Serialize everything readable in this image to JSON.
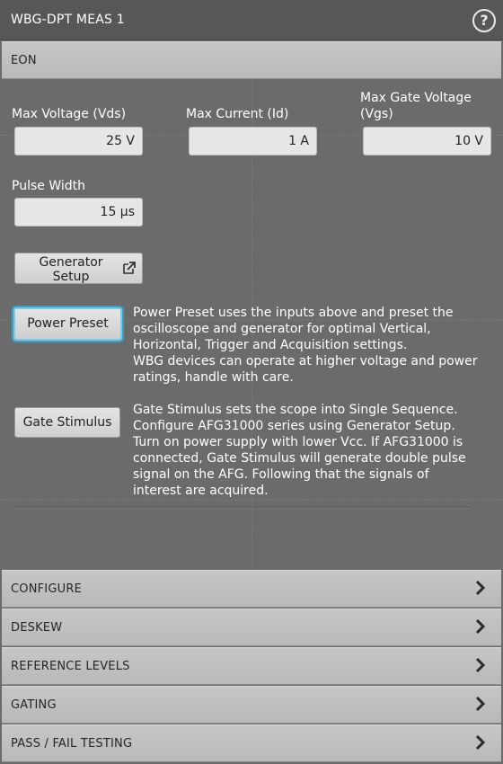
{
  "title": "WBG-DPT MEAS 1",
  "help_icon": "?",
  "eon_header": "EON",
  "fields": {
    "max_voltage": {
      "label": "Max Voltage (Vds)",
      "value": "25 V"
    },
    "max_current": {
      "label": "Max Current (Id)",
      "value": "1 A"
    },
    "max_gate_voltage": {
      "label_line1": "Max Gate Voltage",
      "label_line2": "(Vgs)",
      "value": "10 V"
    },
    "pulse_width": {
      "label": "Pulse Width",
      "value": "15 µs"
    }
  },
  "generator_setup": {
    "line1": "Generator",
    "line2": "Setup",
    "icon": "external-link-icon"
  },
  "power_preset": {
    "label": "Power Preset",
    "desc": [
      "Power Preset uses the inputs above and preset the",
      "oscilloscope and generator for optimal Vertical,",
      "Horizontal, Trigger and Acquisition settings.",
      "WBG devices can operate at higher voltage and power",
      "ratings, handle with care."
    ]
  },
  "gate_stimulus": {
    "label": "Gate Stimulus",
    "desc": [
      "Gate Stimulus sets the scope into Single Sequence.",
      "Configure AFG31000 series using Generator Setup.",
      "Turn on power supply with lower Vcc. If AFG31000 is",
      "connected, Gate Stimulus will generate double pulse",
      "signal on the AFG. Following that the signals of",
      "interest are acquired."
    ]
  },
  "sections": [
    {
      "label": "CONFIGURE"
    },
    {
      "label": "DESKEW"
    },
    {
      "label": "REFERENCE LEVELS"
    },
    {
      "label": "GATING"
    },
    {
      "label": "PASS / FAIL TESTING"
    }
  ],
  "colors": {
    "panel_bg": "#6b6b6b",
    "header_bg": "#c0c0c0",
    "focus_ring": "#3aa0c4"
  }
}
